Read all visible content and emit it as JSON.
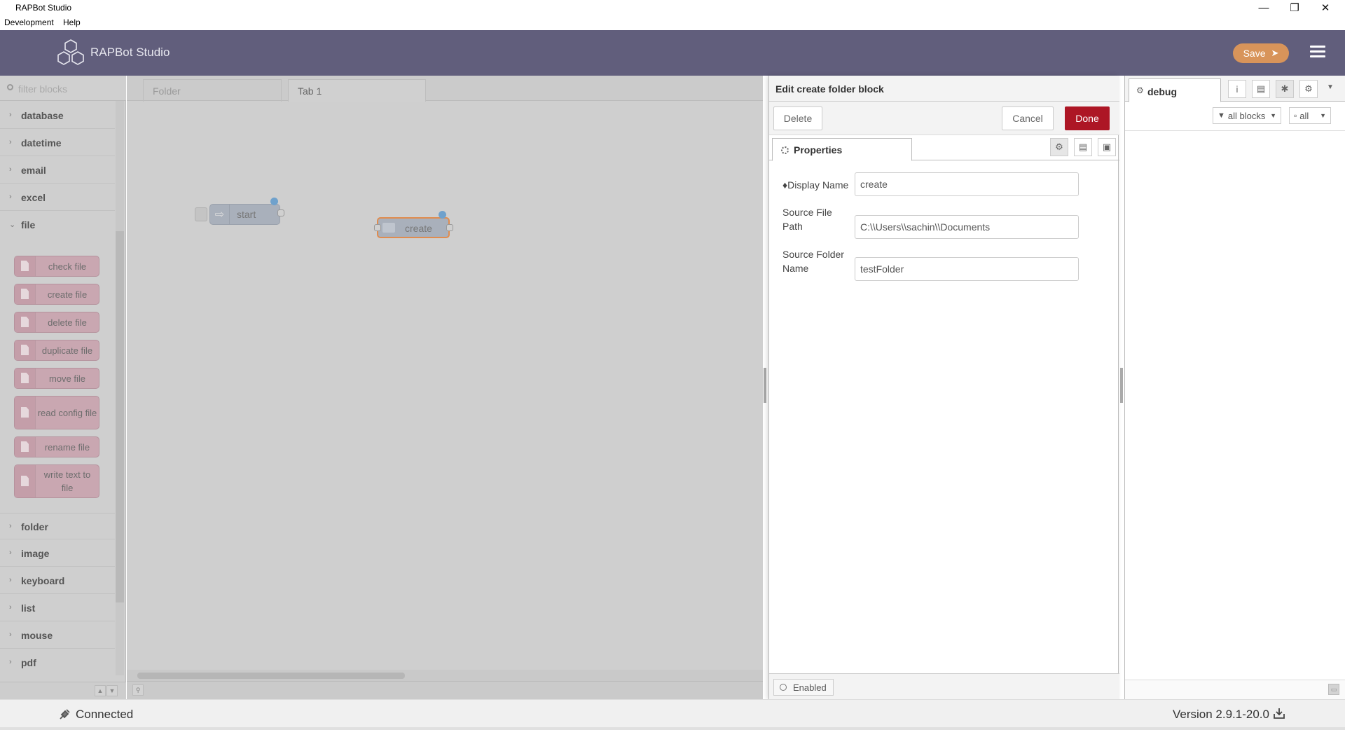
{
  "window": {
    "title": "RAPBot Studio",
    "menu": [
      "Development",
      "Help"
    ]
  },
  "header": {
    "brand": "RAPBot Studio",
    "save_label": "Save"
  },
  "palette": {
    "filter_placeholder": "filter blocks",
    "categories_top": [
      "database",
      "datetime",
      "email",
      "excel",
      "file"
    ],
    "file_nodes": [
      "check file",
      "create file",
      "delete file",
      "duplicate file",
      "move file",
      "read config file",
      "rename file",
      "write text to file"
    ],
    "categories_bottom": [
      "folder",
      "image",
      "keyboard",
      "list",
      "mouse",
      "pdf"
    ]
  },
  "workspace": {
    "tabs": [
      "Folder",
      "Tab 1"
    ],
    "active_tab": "Tab 1",
    "nodes": [
      "start",
      "create"
    ]
  },
  "tray": {
    "title": "Edit create folder block",
    "delete_label": "Delete",
    "cancel_label": "Cancel",
    "done_label": "Done",
    "properties_tab": "Properties",
    "fields": [
      {
        "label": "Display Name",
        "value": "create"
      },
      {
        "label": "Source File Path",
        "value": "C:\\\\Users\\\\sachin\\\\Documents"
      },
      {
        "label": "Source Folder Name",
        "value": "testFolder"
      }
    ],
    "enabled_label": "Enabled"
  },
  "sidebar": {
    "tab": "debug",
    "filter_label": "all blocks",
    "clear_label": "all"
  },
  "status": {
    "connection": "Connected",
    "version": "Version 2.9.1-20.0"
  },
  "colors": {
    "header_bg": "#615e7c",
    "save_bg": "#d8945a",
    "done_bg": "#ad1625",
    "file_node": "#c9a7b1",
    "port_dot": "#6fa1cc"
  }
}
